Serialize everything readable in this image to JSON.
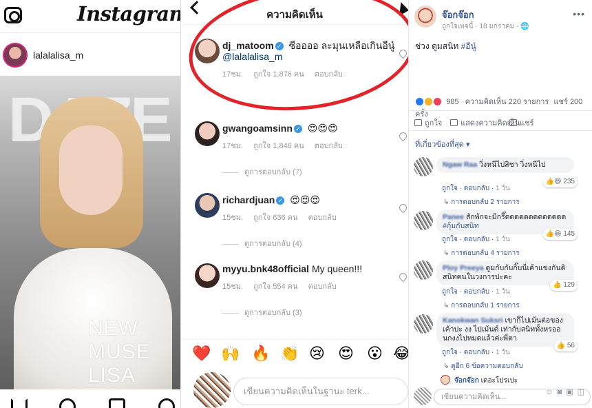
{
  "instagram_post": {
    "logo": "Instagram",
    "username": "lalalalisa_m",
    "photo_masthead": "DAZE",
    "photo_caption_lines": [
      "NEW",
      "MUSE",
      "LISA"
    ]
  },
  "instagram_comments": {
    "title": "ความคิดเห็น",
    "comments": [
      {
        "name": "dj_matoom",
        "text": "ซีออออ ละมุนเหลือเกินอีนู๋",
        "mention": "@lalalalisa_m",
        "time": "17ชม.",
        "likes": "ถูกใจ 1,876 คน",
        "reply": "ตอบกลับ"
      },
      {
        "name": "gwangoamsinn",
        "text": "😍😍😍",
        "time": "17ชม.",
        "likes": "ถูกใจ 1,846 คน",
        "reply": "ตอบกลับ",
        "view_replies": "ดูการตอบกลับ (7)"
      },
      {
        "name": "richardjuan",
        "text": "😍😍😍",
        "time": "15ชม.",
        "likes": "ถูกใจ 636 คน",
        "reply": "ตอบกลับ",
        "view_replies": "ดูการตอบกลับ (4)"
      },
      {
        "name": "myyu.bnk48official",
        "text": "My queen!!!",
        "time": "15ชม.",
        "likes": "ถูกใจ 554 คน",
        "reply": "ตอบกลับ",
        "view_replies": "ดูการตอบกลับ (3)"
      }
    ],
    "quick_emojis": [
      "❤️",
      "🙌",
      "🔥",
      "👏",
      "😢",
      "😍",
      "😮",
      "😂"
    ],
    "reply_placeholder": "เขียนความคิดเห็นในฐานะ terk..."
  },
  "facebook": {
    "page_name": "จ๊อกจ๊อก",
    "meta": "ถูกใจเพจนี้ · 18 มกราคม ·",
    "post_text": "ช่วง ดูมสนิท",
    "post_tag": "#อีนู๋",
    "reaction_count": "985",
    "comment_count": "ความคิดเห็น 220 รายการ",
    "share_count": "แชร์ 200 ครั้ง",
    "action_like": "ถูกใจ",
    "action_comment": "แสดงความคิดเห็น",
    "action_share": "แชร์",
    "sort_label": "ที่เกี่ยวข้องที่สุด",
    "comments": [
      {
        "name": "Ngaw Raa",
        "text": "วิ่งหนีไปสิชา วิ่งหนีไป",
        "tag": "",
        "reactions": "235",
        "like": "ถูกใจ",
        "reply": "ตอบกลับ",
        "time": "1 วัน",
        "replies": "การตอบกลับ 2 รายการ"
      },
      {
        "name": "Panee",
        "text": "สักพักจะมีกรี๊ดดดดดดดดดดดดด",
        "tag": "#กุ้มกับสนิท",
        "reactions": "145",
        "like": "ถูกใจ",
        "reply": "ตอบกลับ",
        "time": "1 วัน",
        "replies": "การตอบกลับ 4 รายการ"
      },
      {
        "name": "Ploy Preeya",
        "text": "ดูมกับกับกิ๊บนี่เค้าแข่งกันติสนิทคนในวงการปะคะ",
        "tag": "",
        "reactions": "129",
        "like": "ถูกใจ",
        "reply": "ตอบกลับ",
        "time": "1 วัน",
        "replies": "การตอบกลับ 1 รายการ"
      },
      {
        "name": "Kanokwan Suksri",
        "text": "เขาก็ไปเม้นต่อของเค้าปะ งง ไปเม้นต์ เท่ากับสนิททั้งหรออ นกงงไปหมดแล้วค่ะพี่ตา",
        "tag": "",
        "reactions": "56",
        "like": "ถูกใจ",
        "reply": "ตอบกลับ",
        "time": "1 วัน",
        "replies": "ดูอีก 6 ข้อความตอบกลับ"
      }
    ],
    "last_reply_name": "จ๊อกจ๊อก",
    "last_reply_text": "เดอะโปรเปะ",
    "write_placeholder": "เขียนความคิดเห็น..."
  }
}
